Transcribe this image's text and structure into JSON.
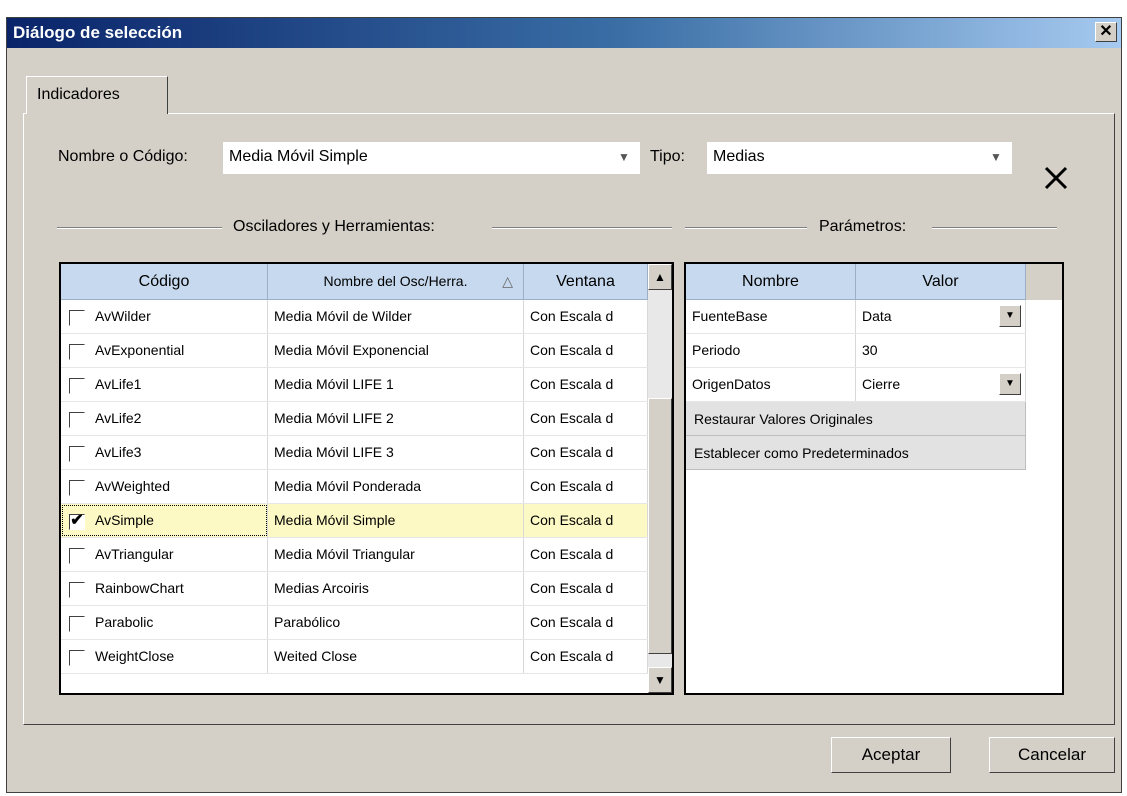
{
  "window": {
    "title": "Diálogo de selección",
    "close_glyph": "✕"
  },
  "tabs": [
    {
      "label": "Indicadores",
      "active": true
    }
  ],
  "filters": {
    "name_label": "Nombre o Código:",
    "name_value": "Media Móvil Simple",
    "type_label": "Tipo:",
    "type_value": "Medias"
  },
  "sections": {
    "left_title": "Osciladores y Herramientas:",
    "right_title": "Parámetros:"
  },
  "indicators_table": {
    "headers": [
      "Código",
      "Nombre del Osc/Herra.",
      "Ventana"
    ],
    "sort_indicator": "sort-ascending-icon",
    "rows": [
      {
        "code": "AvWilder",
        "name": "Media Móvil de Wilder",
        "window": "Con Escala d",
        "checked": false
      },
      {
        "code": "AvExponential",
        "name": "Media Móvil Exponencial",
        "window": "Con Escala d",
        "checked": false
      },
      {
        "code": "AvLife1",
        "name": "Media Móvil LIFE 1",
        "window": "Con Escala d",
        "checked": false
      },
      {
        "code": "AvLife2",
        "name": "Media Móvil LIFE 2",
        "window": "Con Escala d",
        "checked": false
      },
      {
        "code": "AvLife3",
        "name": "Media Móvil LIFE 3",
        "window": "Con Escala d",
        "checked": false
      },
      {
        "code": "AvWeighted",
        "name": "Media Móvil Ponderada",
        "window": "Con Escala d",
        "checked": false
      },
      {
        "code": "AvSimple",
        "name": "Media Móvil Simple",
        "window": "Con Escala d",
        "checked": true
      },
      {
        "code": "AvTriangular",
        "name": "Media Móvil Triangular",
        "window": "Con Escala d",
        "checked": false
      },
      {
        "code": "RainbowChart",
        "name": "Medias Arcoiris",
        "window": "Con Escala d",
        "checked": false
      },
      {
        "code": "Parabolic",
        "name": "Parabólico",
        "window": "Con Escala d",
        "checked": false
      },
      {
        "code": "WeightClose",
        "name": "Weited Close",
        "window": "Con Escala d",
        "checked": false
      }
    ],
    "selected_row": 6,
    "selected_color": "#fdf9c4"
  },
  "params_table": {
    "headers": [
      "Nombre",
      "Valor"
    ],
    "rows": [
      {
        "name": "FuenteBase",
        "value": "Data",
        "dropdown": true
      },
      {
        "name": "Periodo",
        "value": "30",
        "dropdown": false
      },
      {
        "name": "OrigenDatos",
        "value": "Cierre",
        "dropdown": true
      }
    ],
    "actions": [
      "Restaurar Valores Originales",
      "Establecer como Predeterminados"
    ]
  },
  "footer": {
    "ok_label": "Aceptar",
    "cancel_label": "Cancelar"
  }
}
